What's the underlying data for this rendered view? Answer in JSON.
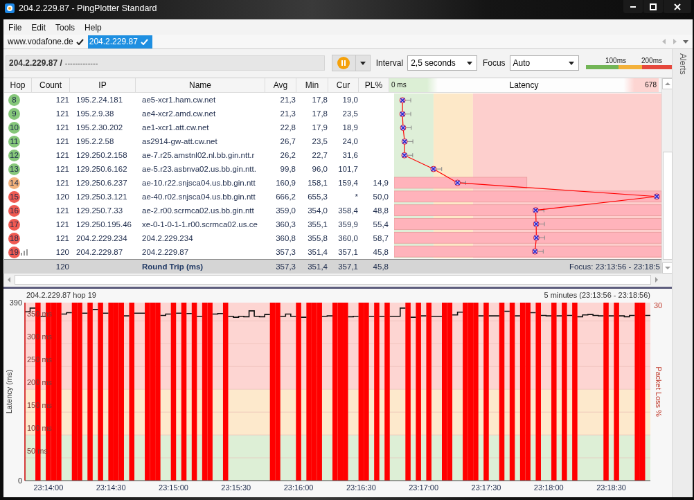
{
  "window": {
    "title": "204.2.229.87 - PingPlotter Standard"
  },
  "menu": [
    {
      "label": "File"
    },
    {
      "label": "Edit"
    },
    {
      "label": "Tools"
    },
    {
      "label": "Help"
    }
  ],
  "targets": [
    {
      "label": "www.vodafone.de",
      "selected": false
    },
    {
      "label": "204.2.229.87",
      "selected": true
    }
  ],
  "toolbar": {
    "address": "204.2.229.87 /",
    "address_detail": "-------------",
    "interval": {
      "label": "Interval",
      "value": "2,5 seconds"
    },
    "focus": {
      "label": "Focus",
      "value": "Auto"
    },
    "legend": [
      "100ms",
      "200ms"
    ]
  },
  "alerts_tab": "Alerts",
  "table": {
    "columns": [
      "Hop",
      "Count",
      "IP",
      "Name",
      "Avg",
      "Min",
      "Cur",
      "PL%",
      "Latency"
    ],
    "latency_scale": {
      "min": "0 ms",
      "max": "678"
    },
    "rows": [
      {
        "hop": "8",
        "count": "121",
        "ip": "195.2.24.181",
        "name": "ae5-xcr1.ham.cw.net",
        "avg": "21,3",
        "min": "17,8",
        "cur": "19,0",
        "color": "#86c77a",
        "graphed": false
      },
      {
        "hop": "9",
        "count": "121",
        "ip": "195.2.9.38",
        "name": "ae4-xcr2.amd.cw.net",
        "avg": "21,3",
        "min": "17,8",
        "cur": "23,5",
        "color": "#86c77a",
        "graphed": false
      },
      {
        "hop": "10",
        "count": "121",
        "ip": "195.2.30.202",
        "name": "ae1-xcr1.att.cw.net",
        "avg": "22,8",
        "min": "17,9",
        "cur": "18,9",
        "color": "#86c77a",
        "graphed": false
      },
      {
        "hop": "11",
        "count": "121",
        "ip": "195.2.2.58",
        "name": "as2914-gw-att.cw.net",
        "avg": "26,7",
        "min": "23,5",
        "cur": "24,0",
        "color": "#86c77a",
        "graphed": false
      },
      {
        "hop": "12",
        "count": "121",
        "ip": "129.250.2.158",
        "name": "ae-7.r25.amstnl02.nl.bb.gin.ntt.r",
        "avg": "26,2",
        "min": "22,7",
        "cur": "31,6",
        "color": "#86c77a",
        "graphed": false
      },
      {
        "hop": "13",
        "count": "121",
        "ip": "129.250.6.162",
        "name": "ae-5.r23.asbnva02.us.bb.gin.ntt.",
        "avg": "99,8",
        "min": "96,0",
        "cur": "101,7",
        "color": "#86c77a",
        "graphed": false
      },
      {
        "hop": "14",
        "count": "121",
        "ip": "129.250.6.237",
        "name": "ae-10.r22.snjsca04.us.bb.gin.ntt",
        "avg": "160,9",
        "min": "158,1",
        "cur": "159,4",
        "pl": "14,9",
        "color": "#f2b27c",
        "graphed": false
      },
      {
        "hop": "15",
        "count": "120",
        "ip": "129.250.3.121",
        "name": "ae-40.r02.snjsca04.us.bb.gin.ntt",
        "avg": "666,2",
        "min": "655,3",
        "cur": "*",
        "pl": "50,0",
        "color": "#ef5a52",
        "graphed": false
      },
      {
        "hop": "16",
        "count": "121",
        "ip": "129.250.7.33",
        "name": "ae-2.r00.scrmca02.us.bb.gin.ntt",
        "avg": "359,0",
        "min": "354,0",
        "cur": "358,4",
        "pl": "48,8",
        "color": "#ef5a52",
        "graphed": false
      },
      {
        "hop": "17",
        "count": "121",
        "ip": "129.250.195.46",
        "name": "xe-0-1-0-1-1.r00.scrmca02.us.ce",
        "avg": "360,3",
        "min": "355,1",
        "cur": "359,9",
        "pl": "55,4",
        "color": "#ef5a52",
        "graphed": false
      },
      {
        "hop": "18",
        "count": "121",
        "ip": "204.2.229.234",
        "name": "204.2.229.234",
        "avg": "360,8",
        "min": "355,8",
        "cur": "360,0",
        "pl": "58,7",
        "color": "#ef5a52",
        "graphed": false
      },
      {
        "hop": "19",
        "count": "120",
        "ip": "204.2.229.87",
        "name": "204.2.229.87",
        "avg": "357,3",
        "min": "351,4",
        "cur": "357,1",
        "pl": "45,8",
        "color": "#ef5a52",
        "graphed": true
      }
    ],
    "summary": {
      "count": "120",
      "label": "Round Trip (ms)",
      "avg": "357,3",
      "min": "351,4",
      "cur": "357,1",
      "pl": "45,8",
      "focus": "Focus: 23:13:56 - 23:18:5"
    }
  },
  "graph": {
    "title": "204.2.229.87 hop 19",
    "range": "5 minutes (23:13:56 - 23:18:56)",
    "y_axis": {
      "label": "Latency (ms)",
      "max": "390",
      "min": "0"
    },
    "gridline_labels": [
      "350 ms",
      "300 ms",
      "250 ms",
      "200 ms",
      "150 ms",
      "100 ms",
      "50 ms"
    ],
    "time_labels": [
      "23:14:00",
      "23:14:30",
      "23:15:00",
      "23:15:30",
      "23:16:00",
      "23:16:30",
      "23:17:00",
      "23:17:30",
      "23:18:00",
      "23:18:30"
    ],
    "loss_axis": {
      "max": "30",
      "label": "Packet Loss %"
    }
  }
}
